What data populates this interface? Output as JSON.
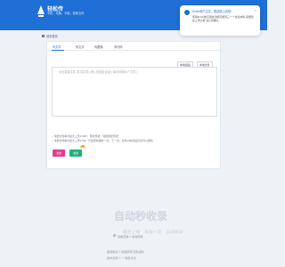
{
  "header": {
    "brand": "轻松传",
    "tagline": "手机、电脑、平板，轻松互传"
  },
  "toast": {
    "title": "Ercilo用户注意，很遗憾上线啦！",
    "body": "使用Ercilo数字通信功能可能有三一个信息或将 需要您 在上传之前 请认真确认"
  },
  "breadcrumb": "首页首页",
  "tabs": [
    {
      "label": "传文件",
      "active": true
    },
    {
      "label": "传文字",
      "active": false
    },
    {
      "label": "传图像",
      "active": false
    },
    {
      "label": "传代码",
      "active": false
    }
  ],
  "toolbar": {
    "clipboard_label": "本地粘贴",
    "clear_label": "本地文件"
  },
  "editor": {
    "placeholder": "点击选择文件 或 将文件 [ 拖 ] 放到此区域 [ 单次可拖50个文件 ]"
  },
  "hints": [
    "• 免费文件单次最大上传1.5MT，轻松传送，轻松轻松传送",
    "• 免费文件单次最大上传1.5M，已加密和保护一次，下一次，文件24时间后仍旧可以更新"
  ],
  "buttons": {
    "send_label": "发送",
    "vip_send_label": "发送",
    "vip_badge": "VIP"
  },
  "watermark": {
    "main": "自动秒收录",
    "sub": "随时上线 · 来访一次 · 自动收录"
  },
  "footer": {
    "line1": "复制互联 © 版权所有",
    "line2": "备案信息 ©  版权所有 隐私保护",
    "line3": "技术支持 © 一  联系方式"
  },
  "colors": {
    "primary": "#1f6fd6",
    "pink": "#e5398f",
    "green": "#21b07c"
  }
}
